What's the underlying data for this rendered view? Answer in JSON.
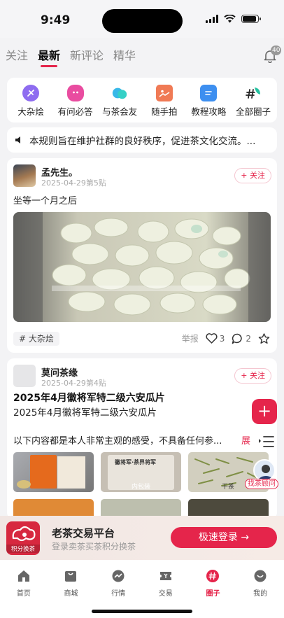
{
  "status_bar": {
    "time": "9:49"
  },
  "top_tabs": [
    {
      "label": "关注",
      "active": false
    },
    {
      "label": "最新",
      "active": true
    },
    {
      "label": "新评论",
      "active": false
    },
    {
      "label": "精华",
      "active": false
    }
  ],
  "notifications": {
    "badge": "40"
  },
  "categories": [
    {
      "label": "大杂烩",
      "icon": "planet-icon",
      "color": "#8e6cf0"
    },
    {
      "label": "有问必答",
      "icon": "chat-face-icon",
      "color": "#e94ca0"
    },
    {
      "label": "与茶会友",
      "icon": "speech-bubbles-icon",
      "color": "#38b8e8"
    },
    {
      "label": "随手拍",
      "icon": "photo-icon",
      "color": "#f07a55"
    },
    {
      "label": "教程攻略",
      "icon": "document-icon",
      "color": "#3d8ff0"
    },
    {
      "label": "全部圈子",
      "icon": "hashtag-icon",
      "color": "#23c2a0"
    }
  ],
  "notice": {
    "text": "本规则旨在维护社群的良好秩序，促进茶文化交流。..."
  },
  "posts": [
    {
      "user": "孟先生。",
      "meta": "2025-04-29第5贴",
      "follow_label": "+ 关注",
      "text": "坐等一个月之后",
      "topic": "# 大杂烩",
      "report": "举报",
      "likes": "3",
      "comments": "2"
    },
    {
      "user": "莫问茶缘",
      "meta": "2025-04-29第4贴",
      "follow_label": "+ 关注",
      "title": "2025年4月徽将军特二级六安瓜片",
      "subtitle": "2025年4月徽将军特二级六安瓜片",
      "excerpt": "以下内容都是本人非常主观的感受，不具备任何参...",
      "expand": "展",
      "thumb_labels": [
        "内包装",
        "干茶",
        "徽将军·茶界将军"
      ]
    }
  ],
  "floating": {
    "add": "+",
    "advisor_tag": "找茶顾问"
  },
  "promo": {
    "logo_text": "积分换茶",
    "title": "老茶交易平台",
    "subtitle": "登录卖茶买茶积分换茶",
    "button": "极速登录 →"
  },
  "bottom_nav": [
    {
      "label": "首页",
      "icon": "home-icon",
      "active": false
    },
    {
      "label": "商城",
      "icon": "shop-icon",
      "active": false
    },
    {
      "label": "行情",
      "icon": "trend-icon",
      "active": false
    },
    {
      "label": "交易",
      "icon": "ticket-icon",
      "active": false
    },
    {
      "label": "圈子",
      "icon": "circle-hash-icon",
      "active": true
    },
    {
      "label": "我的",
      "icon": "profile-icon",
      "active": false
    }
  ],
  "colors": {
    "accent": "#e5254b",
    "background": "#f3f3f5"
  }
}
